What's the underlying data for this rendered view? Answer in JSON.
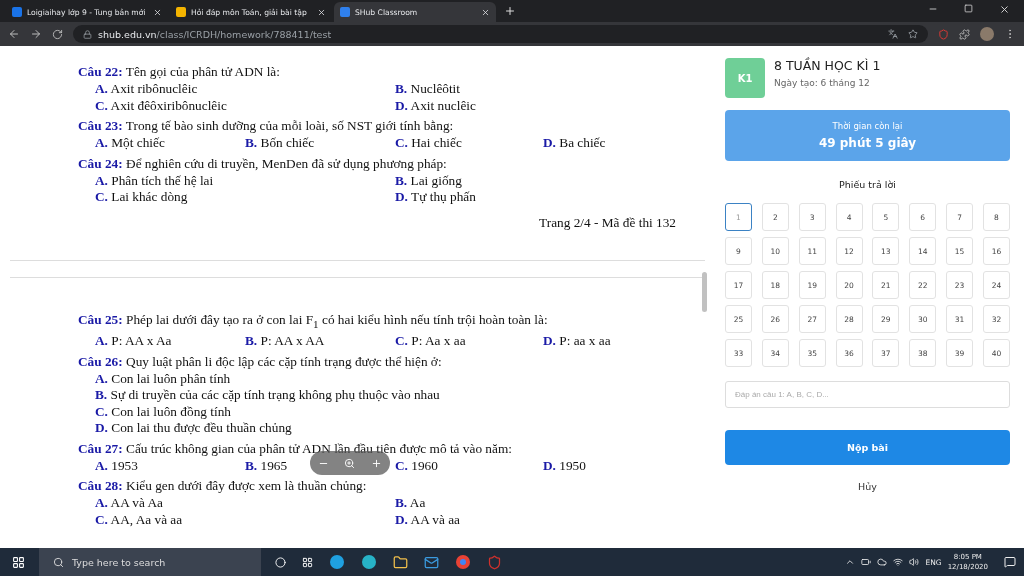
{
  "browser": {
    "tabs": [
      {
        "title": "Loigiaihay lớp 9 - Tung bản mới",
        "color": "#1a73e8",
        "selected": false
      },
      {
        "title": "Hỏi đáp môn Toán, giải bài tập",
        "color": "#f4b400",
        "selected": false
      },
      {
        "title": "SHub Classroom",
        "color": "#2f80ed",
        "selected": true
      }
    ],
    "address": {
      "domain": "shub.edu.vn",
      "path": "/class/ICRDH/homework/788411/test"
    }
  },
  "document": {
    "pages": [
      {
        "questions": [
          {
            "label": "Câu 22:",
            "text": "Tên gọi của phân tử ADN là:",
            "kind": "halves",
            "options": [
              {
                "letter": "A.",
                "text": "Axit ribônuclêic"
              },
              {
                "letter": "B.",
                "text": "Nuclêôtit"
              },
              {
                "letter": "C.",
                "text": "Axit đêôxiribônuclêic"
              },
              {
                "letter": "D.",
                "text": "Axit nuclêic"
              }
            ]
          },
          {
            "label": "Câu 23:",
            "text": "Trong tế bào sinh dưỡng của mỗi loài, số NST giới tính bằng:",
            "kind": "quarters",
            "options": [
              {
                "letter": "A.",
                "text": "Một chiếc"
              },
              {
                "letter": "B.",
                "text": "Bốn chiếc"
              },
              {
                "letter": "C.",
                "text": "Hai chiếc"
              },
              {
                "letter": "D.",
                "text": "Ba chiếc"
              }
            ]
          },
          {
            "label": "Câu 24:",
            "text": "Để nghiên cứu di truyền, MenDen đã sử dụng phương pháp:",
            "kind": "halves",
            "options": [
              {
                "letter": "A.",
                "text": "Phân tích thế hệ lai"
              },
              {
                "letter": "B.",
                "text": "Lai giống"
              },
              {
                "letter": "C.",
                "text": "Lai khác dòng"
              },
              {
                "letter": "D.",
                "text": "Tự thụ phấn"
              }
            ]
          }
        ],
        "footer": "Trang 2/4 - Mã đề thi 132"
      },
      {
        "questions": [
          {
            "label": "Câu 25:",
            "text": "Phép lai dưới đây tạo ra ở con lai F$_{1}$ có hai kiểu hình nếu tính trội hoàn toàn là:",
            "kind": "quarters",
            "options": [
              {
                "letter": "A.",
                "text": "P: AA x Aa"
              },
              {
                "letter": "B.",
                "text": "P: AA x AA"
              },
              {
                "letter": "C.",
                "text": "P: Aa x aa"
              },
              {
                "letter": "D.",
                "text": "P: aa x aa"
              }
            ]
          },
          {
            "label": "Câu 26:",
            "text": "Quy luật phân li độc lập các cặp tính trạng được thể hiện ở:",
            "kind": "lines",
            "options": [
              {
                "letter": "A.",
                "text": "Con lai luôn phân tính"
              },
              {
                "letter": "B.",
                "text": "Sự di truyền của các cặp tính trạng không phụ thuộc vào nhau"
              },
              {
                "letter": "C.",
                "text": "Con lai luôn đồng tính"
              },
              {
                "letter": "D.",
                "text": "Con lai thu được đều thuần chủng"
              }
            ]
          },
          {
            "label": "Câu 27:",
            "text": "Cấu trúc không gian của phân tử ADN lần đầu tiên được mô tả vào năm:",
            "kind": "quarters",
            "options": [
              {
                "letter": "A.",
                "text": "1953"
              },
              {
                "letter": "B.",
                "text": "1965"
              },
              {
                "letter": "C.",
                "text": "1960"
              },
              {
                "letter": "D.",
                "text": "1950"
              }
            ]
          },
          {
            "label": "Câu 28:",
            "text": "Kiểu gen dưới đây được xem là thuần chủng:",
            "kind": "halves",
            "options": [
              {
                "letter": "A.",
                "text": "AA và Aa"
              },
              {
                "letter": "B.",
                "text": "Aa"
              },
              {
                "letter": "C.",
                "text": "AA, Aa và aa"
              },
              {
                "letter": "D.",
                "text": "AA và aa"
              }
            ]
          }
        ]
      }
    ]
  },
  "assignment": {
    "badge": "K1",
    "title": "8 TUẦN HỌC KÌ 1",
    "created": "Ngày tạo: 6 tháng 12"
  },
  "timer": {
    "label": "Thời gian còn lại",
    "value": "49 phút 5 giây"
  },
  "answer_sheet": {
    "title": "Phiếu trả lời",
    "cells": [
      {
        "label": "1",
        "selected": true
      },
      {
        "label": "2",
        "selected": false
      },
      {
        "label": "3",
        "selected": false
      },
      {
        "label": "4",
        "selected": false
      },
      {
        "label": "5",
        "selected": false
      },
      {
        "label": "6",
        "selected": false
      },
      {
        "label": "7",
        "selected": false
      },
      {
        "label": "8",
        "selected": false
      },
      {
        "label": "9",
        "selected": false
      },
      {
        "label": "10",
        "selected": false
      },
      {
        "label": "11",
        "selected": false
      },
      {
        "label": "12",
        "selected": false
      },
      {
        "label": "13",
        "selected": false
      },
      {
        "label": "14",
        "selected": false
      },
      {
        "label": "15",
        "selected": false
      },
      {
        "label": "16",
        "selected": false
      },
      {
        "label": "17",
        "selected": false
      },
      {
        "label": "18",
        "selected": false
      },
      {
        "label": "19",
        "selected": false
      },
      {
        "label": "20",
        "selected": false
      },
      {
        "label": "21",
        "selected": false
      },
      {
        "label": "22",
        "selected": false
      },
      {
        "label": "23",
        "selected": false
      },
      {
        "label": "24",
        "selected": false
      },
      {
        "label": "25",
        "selected": false
      },
      {
        "label": "26",
        "selected": false
      },
      {
        "label": "27",
        "selected": false
      },
      {
        "label": "28",
        "selected": false
      },
      {
        "label": "29",
        "selected": false
      },
      {
        "label": "30",
        "selected": false
      },
      {
        "label": "31",
        "selected": false
      },
      {
        "label": "32",
        "selected": false
      },
      {
        "label": "33",
        "selected": false
      },
      {
        "label": "34",
        "selected": false
      },
      {
        "label": "35",
        "selected": false
      },
      {
        "label": "36",
        "selected": false
      },
      {
        "label": "37",
        "selected": false
      },
      {
        "label": "38",
        "selected": false
      },
      {
        "label": "39",
        "selected": false
      },
      {
        "label": "40",
        "selected": false
      }
    ],
    "placeholder": "Đáp án câu 1: A, B, C, D...",
    "submit": "Nộp bài",
    "cancel": "Hủy"
  },
  "taskbar": {
    "search_placeholder": "Type here to search",
    "language": "ENG",
    "time": "8:05 PM",
    "date": "12/18/2020"
  }
}
